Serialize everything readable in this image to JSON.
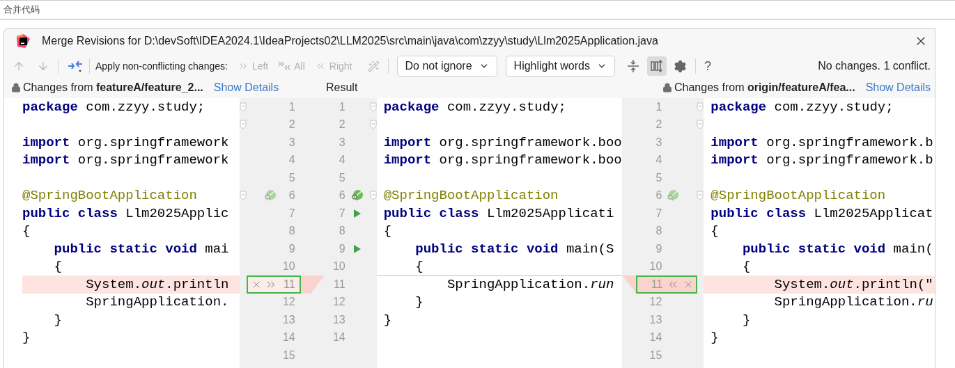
{
  "caption": "合并代码",
  "window": {
    "title": "Merge Revisions for D:\\devSoft\\IDEA2024.1\\IdeaProjects02\\LLM2025\\src\\main\\java\\com\\zzyy\\study\\Llm2025Application.java"
  },
  "toolbar": {
    "apply_label": "Apply non-conflicting changes:",
    "apply_buttons": [
      {
        "kind": "left",
        "label": "Left",
        "disabled": true
      },
      {
        "kind": "all",
        "label": "All",
        "disabled": true
      },
      {
        "kind": "right",
        "label": "Right",
        "disabled": true
      }
    ],
    "dropdowns": [
      {
        "value": "Do not ignore"
      },
      {
        "value": "Highlight words"
      }
    ],
    "side_by_side": {
      "selected": true
    },
    "help": "?",
    "status": "No changes. 1 conflict."
  },
  "header": {
    "left": {
      "text": "Changes from **featureA/feature_2...**",
      "link": "Show Details"
    },
    "center": "Result",
    "right": {
      "text": "Changes from **origin/featureA/fea...**",
      "link": "Show Details"
    }
  },
  "rows": [
    {
      "left": {
        "text": "**package** com.zzyy.study;",
        "fold": true,
        "number": "1"
      },
      "result": {
        "number": "1",
        "fold": true,
        "text": "**package** com.zzyy.study;"
      },
      "right": {
        "number": "1",
        "fold": true,
        "text": "**package** com.zzyy.study;"
      }
    },
    {
      "left": {
        "fold": true,
        "number": "2"
      },
      "result": {
        "number": "2",
        "fold": true
      },
      "right": {
        "number": "2",
        "fold": true
      }
    },
    {
      "left": {
        "text": "**import** org.springframework",
        "number": "3"
      },
      "result": {
        "number": "3",
        "text": "**import** org.springframework.boo"
      },
      "right": {
        "number": "3",
        "text": "**import** org.springframework.b"
      }
    },
    {
      "left": {
        "text": "**import** org.springframework",
        "number": "4"
      },
      "result": {
        "number": "4",
        "text": "**import** org.springframework.boo"
      },
      "right": {
        "number": "4",
        "text": "**import** org.springframework.b"
      }
    },
    {
      "left": {
        "number": "5"
      },
      "result": {
        "number": "5"
      },
      "right": {
        "number": "5"
      }
    },
    {
      "left": {
        "text": "@SpringBootApplication",
        "kind": "annotation",
        "fold": true,
        "bean_marker": true,
        "number": "6"
      },
      "result": {
        "number": "6",
        "bean_marker": true,
        "fold": true,
        "text": "@SpringBootApplication",
        "kind": "annotation"
      },
      "right": {
        "number": "6",
        "bean_marker": true,
        "fold": true,
        "text": "@SpringBootApplication",
        "kind": "annotation"
      }
    },
    {
      "left": {
        "text": "**public class** Llm2025Applic",
        "number": "7"
      },
      "result": {
        "number": "7",
        "run_marker": true,
        "text": "**public class** Llm2025Applicati"
      },
      "right": {
        "number": "7",
        "text": "**public class** Llm2025Applicat"
      }
    },
    {
      "left": {
        "text": "{",
        "number": "8"
      },
      "result": {
        "number": "8",
        "text": "{"
      },
      "right": {
        "number": "8",
        "text": "{"
      }
    },
    {
      "left": {
        "text": "    **public static void** mai",
        "number": "9"
      },
      "result": {
        "number": "9",
        "run_marker": true,
        "text": "    **public static void** main(S"
      },
      "right": {
        "number": "9",
        "text": "    **public static void** main("
      }
    },
    {
      "left": {
        "text": "    {",
        "number": "10"
      },
      "result": {
        "number": "10",
        "text": "    {"
      },
      "right": {
        "number": "10",
        "text": "    {"
      }
    },
    {
      "left": {
        "text": "        System.*out*.println",
        "conflict": true,
        "framed": true,
        "number": "11"
      },
      "result": {
        "number": "11",
        "conflict": true,
        "text": "        SpringApplication.*run*"
      },
      "right": {
        "number": "11",
        "conflict": true,
        "framed": true,
        "text": "        System.*out*.println(\""
      }
    },
    {
      "left": {
        "text": "        SpringApplication.",
        "number": "12"
      },
      "result": {
        "number": "12",
        "text": "    }"
      },
      "right": {
        "number": "12",
        "text": "        SpringApplication.*ru*"
      }
    },
    {
      "left": {
        "text": "    }",
        "number": "13"
      },
      "result": {
        "number": "13",
        "text": "}"
      },
      "right": {
        "number": "13",
        "text": "    }"
      }
    },
    {
      "left": {
        "text": "}",
        "number": "14"
      },
      "result": {
        "number": "14"
      },
      "right": {
        "number": "14",
        "text": "}"
      }
    },
    {
      "left": {
        "number": "15"
      },
      "right": {
        "number": "15"
      }
    }
  ]
}
